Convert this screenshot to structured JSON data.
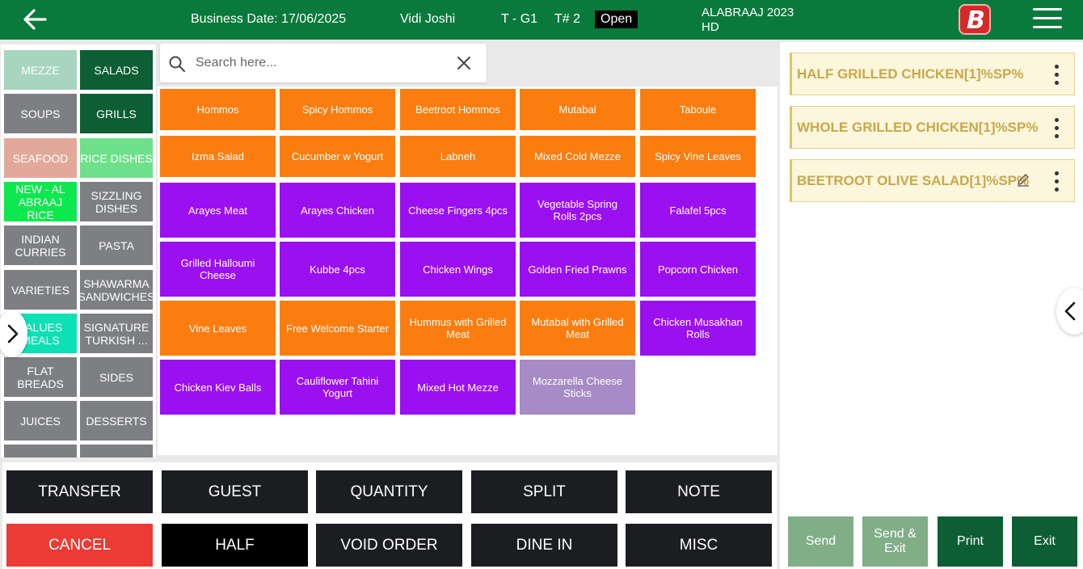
{
  "header": {
    "business_date": "Business Date: 17/06/2025",
    "user": "Vidi Joshi",
    "table": "T - G1",
    "ticket": "T# 2",
    "status": "Open",
    "branch_line1": "ALABRAAJ 2023",
    "branch_line2": "HD",
    "logo_letter": "B",
    "back_icon": "arrow-left-icon",
    "menu_icon": "hamburger-menu-icon"
  },
  "search": {
    "placeholder": "Search here..."
  },
  "categories": [
    {
      "label": "MEZZE",
      "color": "#a8d5bf"
    },
    {
      "label": "SALADS",
      "color": "#0d5e35"
    },
    {
      "label": "SOUPS",
      "color": "#7d7f83"
    },
    {
      "label": "GRILLS",
      "color": "#0d5e35"
    },
    {
      "label": "SEAFOOD",
      "color": "#e2a99b"
    },
    {
      "label": "RICE DISHES",
      "color": "#6ee08b"
    },
    {
      "label": "NEW - AL ABRAAJ RICE",
      "color": "#0de84f"
    },
    {
      "label": "SIZZLING DISHES",
      "color": "#7d7f83"
    },
    {
      "label": "INDIAN CURRIES",
      "color": "#7d7f83"
    },
    {
      "label": "PASTA",
      "color": "#7d7f83"
    },
    {
      "label": "VARIETIES",
      "color": "#7d7f83"
    },
    {
      "label": "SHAWARMA SANDWICHES",
      "color": "#7d7f83"
    },
    {
      "label": "VALUES MEALS",
      "color": "#0de0b4"
    },
    {
      "label": "SIGNATURE TURKISH ...",
      "color": "#7d7f83"
    },
    {
      "label": "FLAT BREADS",
      "color": "#7d7f83"
    },
    {
      "label": "SIDES",
      "color": "#7d7f83"
    },
    {
      "label": "JUICES",
      "color": "#7d7f83"
    },
    {
      "label": "DESSERTS",
      "color": "#7d7f83"
    }
  ],
  "items": [
    {
      "label": "Hommos",
      "color": "#fb7d10"
    },
    {
      "label": "Spicy Hommos",
      "color": "#fb7d10"
    },
    {
      "label": "Beetroot Hommos",
      "color": "#fb7d10"
    },
    {
      "label": "Mutabal",
      "color": "#fb7d10"
    },
    {
      "label": "Taboule",
      "color": "#fb7d10"
    },
    {
      "label": "Izma Salad",
      "color": "#fb7d10"
    },
    {
      "label": "Cucumber w Yogurt",
      "color": "#fb7d10"
    },
    {
      "label": "Labneh",
      "color": "#fb7d10"
    },
    {
      "label": "Mixed Cold Mezze",
      "color": "#fb7d10"
    },
    {
      "label": "Spicy Vine Leaves",
      "color": "#fb7d10"
    },
    {
      "label": "Arayes Meat",
      "color": "#9b10f1"
    },
    {
      "label": "Arayes Chicken",
      "color": "#9b10f1"
    },
    {
      "label": "Cheese Fingers 4pcs",
      "color": "#9b10f1"
    },
    {
      "label": "Vegetable Spring Rolls 2pcs",
      "color": "#9b10f1"
    },
    {
      "label": "Falafel 5pcs",
      "color": "#9b10f1"
    },
    {
      "label": "Grilled Halloumi Cheese",
      "color": "#9b10f1"
    },
    {
      "label": "Kubbe 4pcs",
      "color": "#9b10f1"
    },
    {
      "label": "Chicken Wings",
      "color": "#9b10f1"
    },
    {
      "label": "Golden Fried Prawns",
      "color": "#9b10f1"
    },
    {
      "label": "Popcorn Chicken",
      "color": "#9b10f1"
    },
    {
      "label": "Vine Leaves",
      "color": "#fb7d10"
    },
    {
      "label": "Free Welcome Starter",
      "color": "#fb7d10"
    },
    {
      "label": "Hummus with Grilled Meat",
      "color": "#fb7d10"
    },
    {
      "label": "Mutabal with Grilled Meat",
      "color": "#fb7d10"
    },
    {
      "label": "Chicken Musakhan Rolls",
      "color": "#9b10f1"
    },
    {
      "label": "Chicken Kiev Balls",
      "color": "#9b10f1"
    },
    {
      "label": "Cauliflower Tahini Yogurt",
      "color": "#9b10f1"
    },
    {
      "label": "Mixed Hot Mezze",
      "color": "#9b10f1"
    },
    {
      "label": "Mozzarella Cheese Sticks",
      "color": "#a68bc6"
    }
  ],
  "actions": [
    {
      "label": "TRANSFER",
      "color": "#1b1d20"
    },
    {
      "label": "GUEST",
      "color": "#1b1d20"
    },
    {
      "label": "QUANTITY",
      "color": "#1b1d20"
    },
    {
      "label": "SPLIT",
      "color": "#1b1d20"
    },
    {
      "label": "NOTE",
      "color": "#1b1d20"
    },
    {
      "label": "CANCEL",
      "color": "#ec3a34"
    },
    {
      "label": "HALF",
      "color": "#000000"
    },
    {
      "label": "VOID ORDER",
      "color": "#1b1d20"
    },
    {
      "label": "DINE IN",
      "color": "#1b1d20"
    },
    {
      "label": "MISC",
      "color": "#1b1d20"
    }
  ],
  "order_lines": [
    {
      "label": "HALF GRILLED CHICKEN[1]%SP%",
      "editable": false
    },
    {
      "label": "WHOLE GRILLED CHICKEN[1]%SP%",
      "editable": false
    },
    {
      "label": "BEETROOT OLIVE SALAD[1]%SP%",
      "editable": true
    }
  ],
  "bottom_buttons": [
    {
      "label": "Send",
      "color": "#81ad87"
    },
    {
      "label": "Send & Exit",
      "color": "#81ad87"
    },
    {
      "label": "Print",
      "color": "#0d5e35"
    },
    {
      "label": "Exit",
      "color": "#0d5e35"
    }
  ],
  "icons": {
    "search": "search-icon",
    "clear": "close-icon",
    "left_expand": "chevron-right-icon",
    "right_collapse": "chevron-left-icon",
    "order_menu": "kebab-menu-icon",
    "order_edit": "pencil-icon"
  }
}
